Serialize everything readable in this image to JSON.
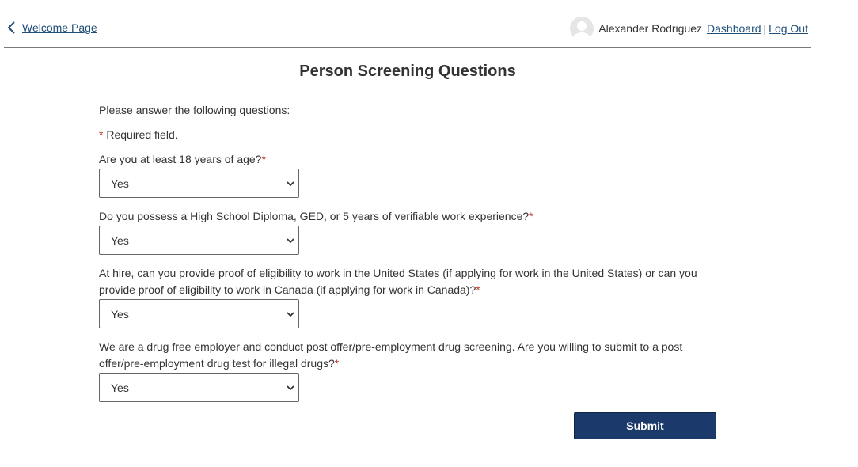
{
  "header": {
    "back_link": "Welcome Page",
    "user_name": "Alexander Rodriguez",
    "dashboard_link": "Dashboard",
    "separator": "|",
    "logout_link": "Log Out"
  },
  "page": {
    "title": "Person Screening Questions",
    "intro": "Please answer the following questions:",
    "required_note": "Required field.",
    "required_mark": "*"
  },
  "questions": [
    {
      "text": "Are you at least 18 years of age?",
      "selected": "Yes"
    },
    {
      "text": "Do you possess a High School Diploma, GED, or 5 years of verifiable work experience?",
      "selected": "Yes"
    },
    {
      "text": "At hire, can you provide proof of eligibility to work in the United States (if applying for work in the United States) or can you provide proof of eligibility to work in Canada (if applying for work in Canada)?",
      "selected": "Yes"
    },
    {
      "text": "We are a drug free employer and conduct post offer/pre-employment drug screening. Are you willing to submit to a post offer/pre-employment drug test for illegal drugs?",
      "selected": "Yes"
    }
  ],
  "actions": {
    "submit_label": "Submit"
  },
  "colors": {
    "link": "#1f4e79",
    "primary_button": "#1b3a6b",
    "required": "#c0392b"
  },
  "icons": {
    "back": "chevron-left-icon",
    "avatar": "user-avatar-icon",
    "select": "chevron-down-icon"
  }
}
